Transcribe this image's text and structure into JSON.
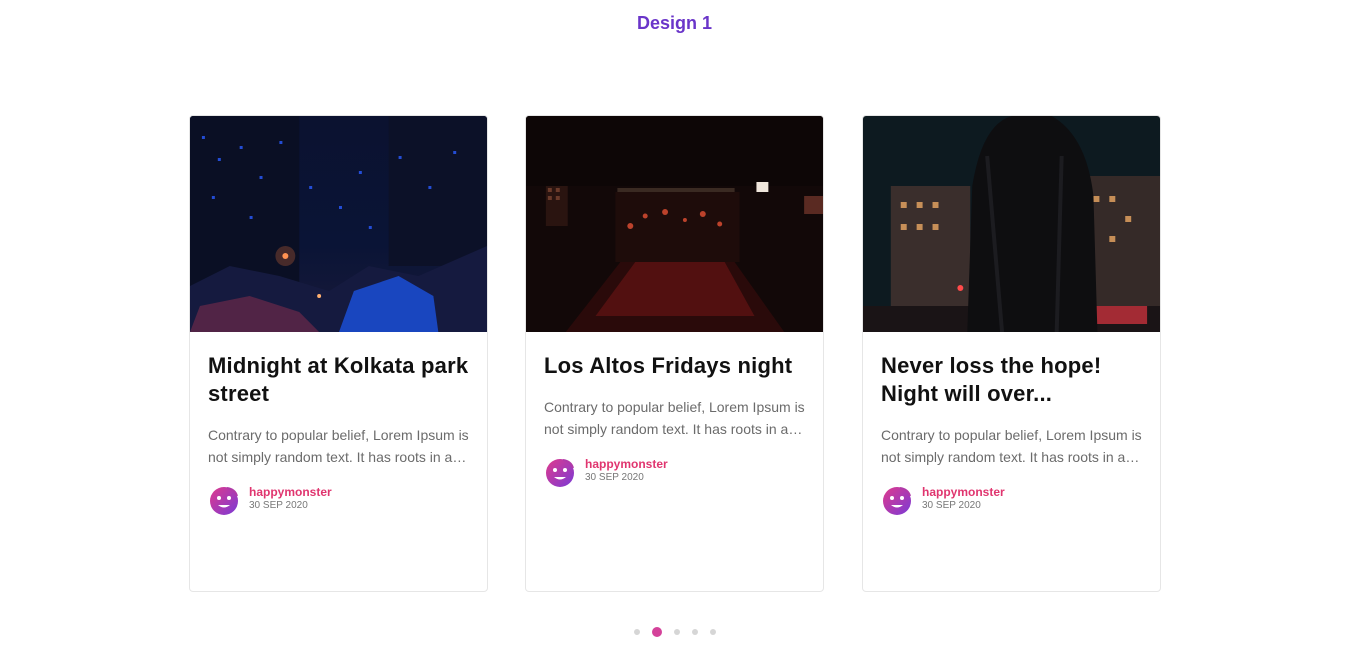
{
  "page": {
    "title": "Design 1"
  },
  "colors": {
    "title": "#6a35c9",
    "author": "#e0356f",
    "active_dot": "#d4429a",
    "inactive_dot": "#d6d6d6"
  },
  "cards": [
    {
      "title": "Midnight at Kolkata park street",
      "excerpt": "Contrary to popular belief, Lorem Ipsum is not simply random text. It has roots in a piece of classical Latin literature",
      "author": "happymonster",
      "date": "30 SEP 2020",
      "image_icon": "night-city-street-photo"
    },
    {
      "title": "Los Altos Fridays night",
      "excerpt": "Contrary to popular belief, Lorem Ipsum is not simply random text. It has roots in a piece of classical Latin literature",
      "author": "happymonster",
      "date": "30 SEP 2020",
      "image_icon": "night-restaurant-photo"
    },
    {
      "title": "Never loss the hope! Night will over...",
      "excerpt": "Contrary to popular belief, Lorem Ipsum is not simply random text. It has roots in a piece of classical Latin literature",
      "author": "happymonster",
      "date": "30 SEP 2020",
      "image_icon": "man-in-leather-jacket-photo"
    }
  ],
  "carousel": {
    "slide_count": 5,
    "active_index": 1
  }
}
